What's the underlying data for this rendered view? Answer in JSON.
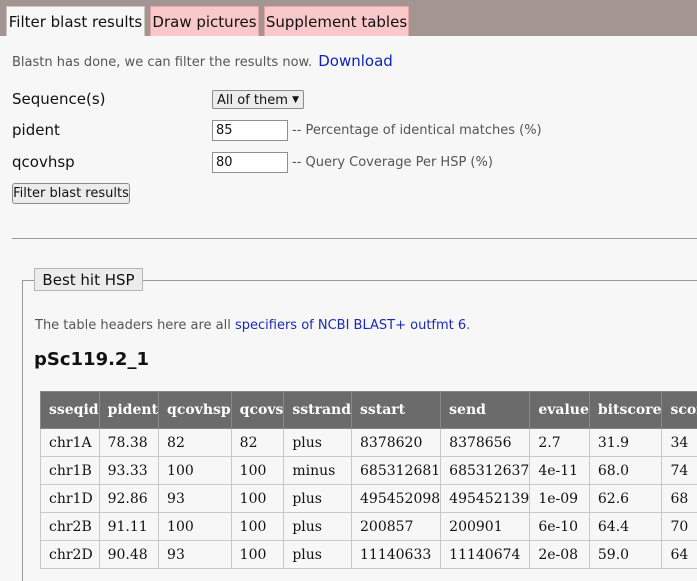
{
  "tabs": [
    {
      "label": "Filter blast results",
      "active": true
    },
    {
      "label": "Draw pictures",
      "active": false
    },
    {
      "label": "Supplement tables",
      "active": false
    }
  ],
  "intro": {
    "text": "Blastn has done, we can filter the results now.",
    "link": "Download"
  },
  "form": {
    "sequence_label": "Sequence(s)",
    "sequence_value": "All of them",
    "pident_label": "pident",
    "pident_value": "85",
    "pident_hint": "-- Percentage of identical matches (%)",
    "qcovhsp_label": "qcovhsp",
    "qcovhsp_value": "80",
    "qcovhsp_hint": "-- Query Coverage Per HSP (%)",
    "submit_label": "Filter blast results"
  },
  "best_hit": {
    "legend": "Best hit HSP",
    "note_prefix": "The table headers here are all ",
    "note_link": "specifiers of NCBI BLAST+ outfmt 6",
    "note_suffix": ".",
    "sequence_name": "pSc119.2_1"
  },
  "table": {
    "headers": [
      "sseqid",
      "pident",
      "qcovhsp",
      "qcovs",
      "sstrand",
      "sstart",
      "send",
      "evalue",
      "bitscore",
      "score"
    ],
    "rows": [
      [
        "chr1A",
        "78.38",
        "82",
        "82",
        "plus",
        "8378620",
        "8378656",
        "2.7",
        "31.9",
        "34"
      ],
      [
        "chr1B",
        "93.33",
        "100",
        "100",
        "minus",
        "685312681",
        "685312637",
        "4e-11",
        "68.0",
        "74"
      ],
      [
        "chr1D",
        "92.86",
        "93",
        "100",
        "plus",
        "495452098",
        "495452139",
        "1e-09",
        "62.6",
        "68"
      ],
      [
        "chr2B",
        "91.11",
        "100",
        "100",
        "plus",
        "200857",
        "200901",
        "6e-10",
        "64.4",
        "70"
      ],
      [
        "chr2D",
        "90.48",
        "93",
        "100",
        "plus",
        "11140633",
        "11140674",
        "2e-08",
        "59.0",
        "64"
      ]
    ]
  },
  "colors": {
    "tabbar": "#a39591",
    "inactive_tab": "#f9c8ca",
    "link": "#0b25b8",
    "table_header": "#6b6b6b"
  }
}
